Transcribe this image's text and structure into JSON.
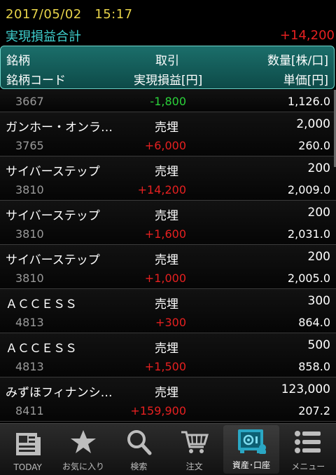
{
  "status": {
    "datetime": "2017/05/02　15:17"
  },
  "summary": {
    "label": "実現損益合計",
    "value": "+14,200"
  },
  "header": {
    "col1_top": "銘柄",
    "col2_top": "取引",
    "col3_top": "数量[株/口]",
    "col1_bottom": "銘柄コード",
    "col2_bottom": "実現損益[円]",
    "col3_bottom": "単価[円]"
  },
  "partial_row": {
    "code": "3667",
    "pnl": "-1,800",
    "price": "1,126.0"
  },
  "rows": [
    {
      "name": "ガンホー・オンラ…",
      "type": "売埋",
      "qty": "2,000",
      "code": "3765",
      "pnl": "+6,000",
      "price": "260.0"
    },
    {
      "name": "サイバーステップ",
      "type": "売埋",
      "qty": "200",
      "code": "3810",
      "pnl": "+14,200",
      "price": "2,009.0"
    },
    {
      "name": "サイバーステップ",
      "type": "売埋",
      "qty": "200",
      "code": "3810",
      "pnl": "+1,600",
      "price": "2,031.0"
    },
    {
      "name": "サイバーステップ",
      "type": "売埋",
      "qty": "200",
      "code": "3810",
      "pnl": "+1,000",
      "price": "2,005.0"
    },
    {
      "name": "ＡＣＣＥＳＳ",
      "type": "売埋",
      "qty": "300",
      "code": "4813",
      "pnl": "+300",
      "price": "864.0"
    },
    {
      "name": "ＡＣＣＥＳＳ",
      "type": "売埋",
      "qty": "500",
      "code": "4813",
      "pnl": "+1,500",
      "price": "858.0"
    },
    {
      "name": "みずほフィナンシ…",
      "type": "売埋",
      "qty": "123,000",
      "code": "8411",
      "pnl": "+159,900",
      "price": "207.2"
    }
  ],
  "nav": [
    {
      "label": "TODAY",
      "icon": "newspaper-icon"
    },
    {
      "label": "お気に入り",
      "icon": "star-icon"
    },
    {
      "label": "検索",
      "icon": "search-icon"
    },
    {
      "label": "注文",
      "icon": "cart-icon"
    },
    {
      "label": "資産･口座",
      "icon": "safe-icon"
    },
    {
      "label": "メニュー",
      "icon": "menu-icon"
    }
  ],
  "colors": {
    "positive": "#e62020",
    "negative": "#2bd23a",
    "accent": "#3fd0cf",
    "date": "#e8d44a"
  }
}
